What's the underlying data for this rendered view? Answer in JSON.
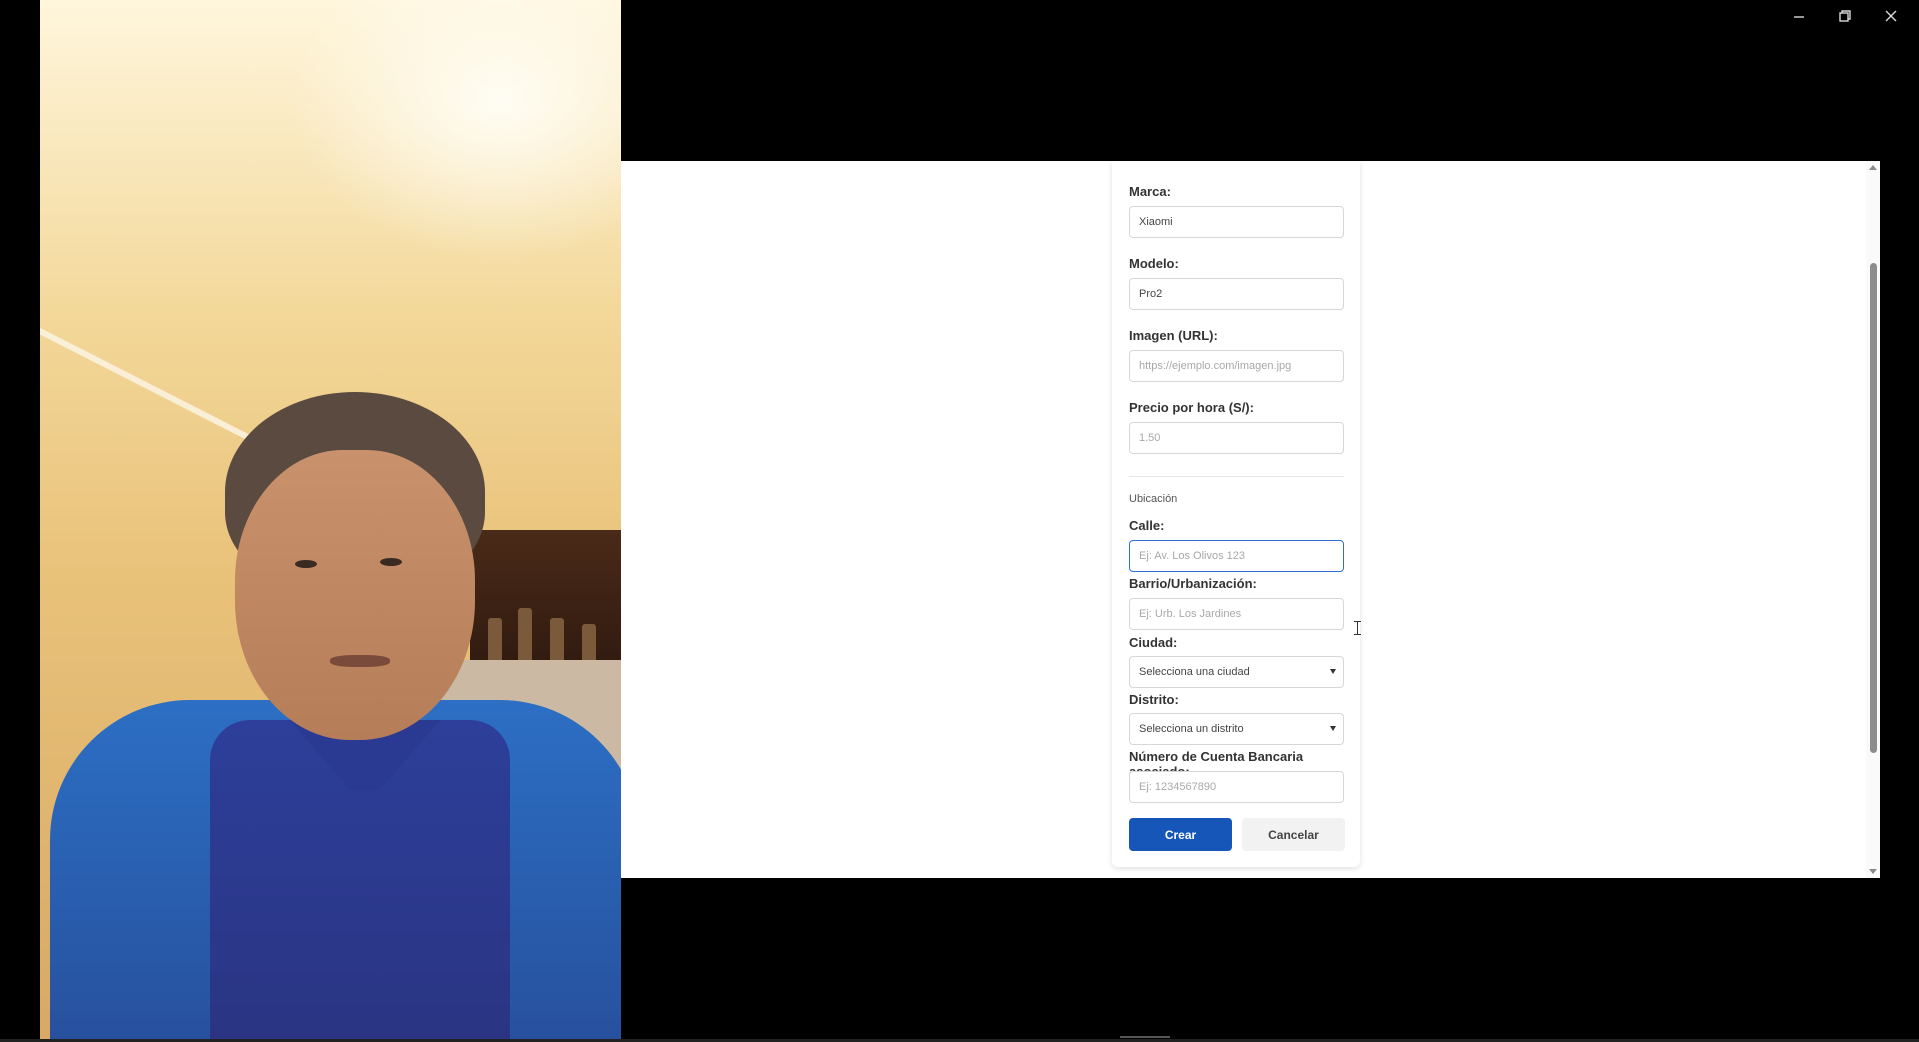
{
  "window": {
    "controls": [
      "minimize-icon",
      "restore-icon",
      "close-icon"
    ]
  },
  "form": {
    "marca": {
      "label": "Marca:",
      "value": "Xiaomi"
    },
    "modelo": {
      "label": "Modelo:",
      "value": "Pro2"
    },
    "imagen": {
      "label": "Imagen (URL):",
      "placeholder": "https://ejemplo.com/imagen.jpg"
    },
    "precio": {
      "label": "Precio por hora (S/):",
      "placeholder": "1.50"
    },
    "section_title": "Ubicación",
    "calle": {
      "label": "Calle:",
      "placeholder": "Ej: Av. Los Olivos 123"
    },
    "barrio": {
      "label": "Barrio/Urbanización:",
      "placeholder": "Ej: Urb. Los Jardines"
    },
    "ciudad": {
      "label": "Ciudad:",
      "selected": "Selecciona una ciudad"
    },
    "distrito": {
      "label": "Distrito:",
      "selected": "Selecciona un distrito"
    },
    "cuenta": {
      "label": "Número de Cuenta Bancaria asociado:",
      "placeholder": "Ej: 1234567890"
    },
    "buttons": {
      "create": "Crear",
      "cancel": "Cancelar"
    }
  },
  "colors": {
    "primary_button": "#1656b8",
    "focus_border": "#2f6fd6",
    "background": "#000000"
  }
}
